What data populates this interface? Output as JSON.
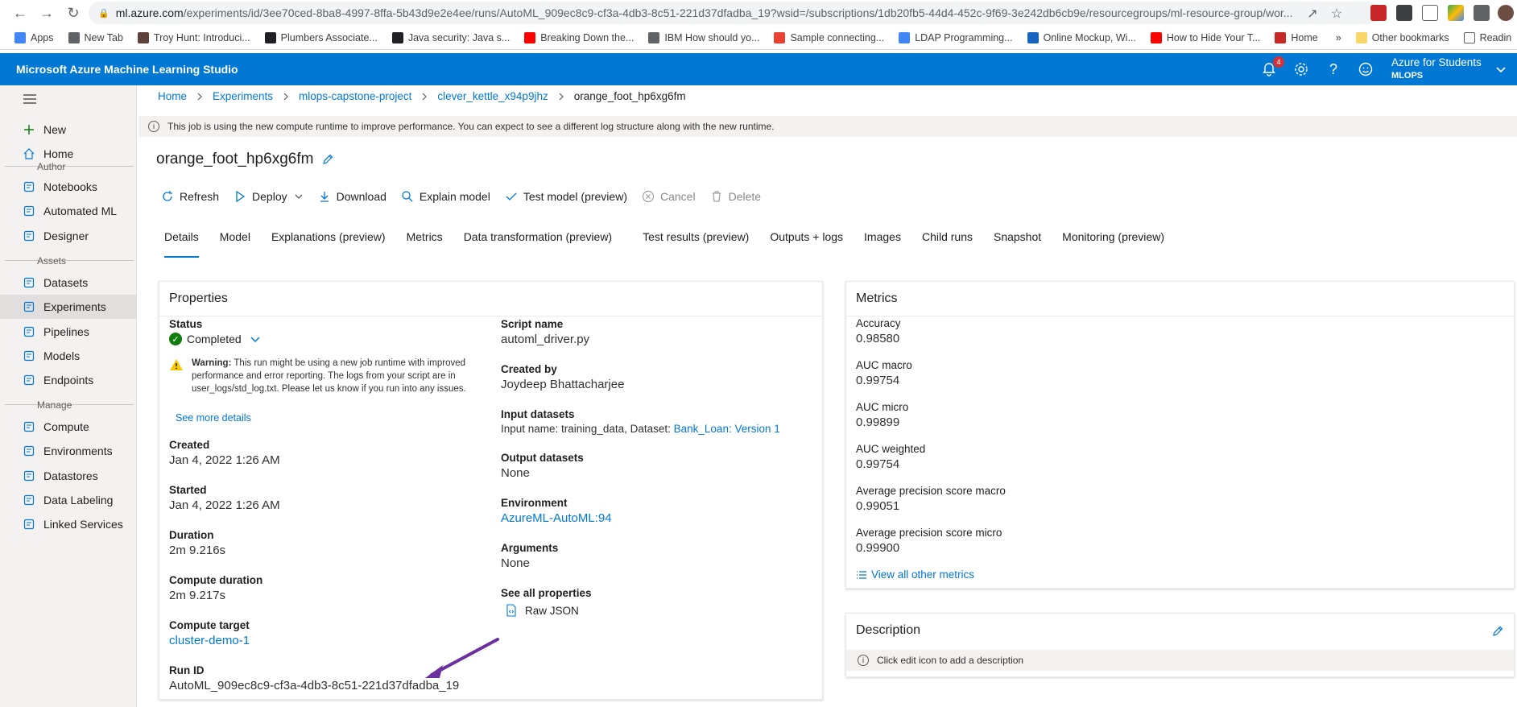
{
  "browser": {
    "url_host": "ml.azure.com",
    "url_path": "/experiments/id/3ee70ced-8ba8-4997-8ffa-5b43d9e2e4ee/runs/AutoML_909ec8c9-cf3a-4db3-8c51-221d37dfadba_19?wsid=/subscriptions/1db20fb5-44d4-452c-9f69-3e242db6cb9e/resourcegroups/ml-resource-group/wor...",
    "bookmarks": [
      {
        "label": "Apps",
        "color": "#4285f4"
      },
      {
        "label": "New Tab",
        "color": "#5f6368"
      },
      {
        "label": "Troy Hunt: Introduci...",
        "color": "#5d4037"
      },
      {
        "label": "Plumbers Associate...",
        "color": "#202124"
      },
      {
        "label": "Java security: Java s...",
        "color": "#202124"
      },
      {
        "label": "Breaking Down the...",
        "color": "#ff0000"
      },
      {
        "label": "IBM How should yo...",
        "color": "#5f6368"
      },
      {
        "label": "Sample connecting...",
        "color": "#ea4335"
      },
      {
        "label": "LDAP Programming...",
        "color": "#4285f4"
      },
      {
        "label": "Online Mockup, Wi...",
        "color": "#1565c0"
      },
      {
        "label": "How to Hide Your T...",
        "color": "#ff0000"
      },
      {
        "label": "Home",
        "color": "#c62828"
      }
    ],
    "more_bookmarks": "»",
    "other_bookmarks": "Other bookmarks",
    "reading_list": "Readin"
  },
  "header": {
    "title": "Microsoft Azure Machine Learning Studio",
    "notif_count": "4",
    "account_name": "Azure for Students",
    "account_sub": "MLOPS"
  },
  "sidebar": {
    "items": [
      {
        "label": "New",
        "icon": "plus-icon"
      },
      {
        "label": "Home",
        "icon": "home-icon"
      }
    ],
    "author_label": "Author",
    "author_items": [
      {
        "label": "Notebooks",
        "icon": "notebook-icon"
      },
      {
        "label": "Automated ML",
        "icon": "automl-icon"
      },
      {
        "label": "Designer",
        "icon": "designer-icon"
      }
    ],
    "assets_label": "Assets",
    "assets_items": [
      {
        "label": "Datasets",
        "icon": "dataset-icon"
      },
      {
        "label": "Experiments",
        "icon": "flask-icon"
      },
      {
        "label": "Pipelines",
        "icon": "pipeline-icon"
      },
      {
        "label": "Models",
        "icon": "model-icon"
      },
      {
        "label": "Endpoints",
        "icon": "endpoint-icon"
      }
    ],
    "manage_label": "Manage",
    "manage_items": [
      {
        "label": "Compute",
        "icon": "compute-icon"
      },
      {
        "label": "Environments",
        "icon": "environment-icon"
      },
      {
        "label": "Datastores",
        "icon": "datastore-icon"
      },
      {
        "label": "Data Labeling",
        "icon": "label-icon"
      },
      {
        "label": "Linked Services",
        "icon": "link-icon"
      }
    ]
  },
  "breadcrumb": [
    "Home",
    "Experiments",
    "mlops-capstone-project",
    "clever_kettle_x94p9jhz",
    "orange_foot_hp6xg6fm"
  ],
  "notice": "This job is using the new compute runtime to improve performance. You can expect to see a different log structure along with the new runtime.",
  "run_title": "orange_foot_hp6xg6fm",
  "toolbar": {
    "refresh": "Refresh",
    "deploy": "Deploy",
    "download": "Download",
    "explain": "Explain model",
    "test": "Test model (preview)",
    "cancel": "Cancel",
    "delete": "Delete"
  },
  "tabs": [
    "Details",
    "Model",
    "Explanations (preview)",
    "Metrics",
    "Data transformation (preview)",
    "Test results (preview)",
    "Outputs + logs",
    "Images",
    "Child runs",
    "Snapshot",
    "Monitoring (preview)"
  ],
  "properties": {
    "title": "Properties",
    "status_label": "Status",
    "status_value": "Completed",
    "warning_bold": "Warning:",
    "warning_text": " This run might be using a new job runtime with improved performance and error reporting. The logs from your script are in user_logs/std_log.txt. Please let us know if you run into any issues.",
    "see_more": "See more details",
    "created_label": "Created",
    "created_value": "Jan 4, 2022 1:26 AM",
    "started_label": "Started",
    "started_value": "Jan 4, 2022 1:26 AM",
    "duration_label": "Duration",
    "duration_value": "2m 9.216s",
    "compute_duration_label": "Compute duration",
    "compute_duration_value": "2m 9.217s",
    "compute_target_label": "Compute target",
    "compute_target_value": "cluster-demo-1",
    "run_id_label": "Run ID",
    "run_id_value": "AutoML_909ec8c9-cf3a-4db3-8c51-221d37dfadba_19",
    "script_name_label": "Script name",
    "script_name_value": "automl_driver.py",
    "created_by_label": "Created by",
    "created_by_value": "Joydeep Bhattacharjee",
    "input_datasets_label": "Input datasets",
    "input_datasets_prefix": "Input name: training_data, Dataset: ",
    "input_datasets_link": "Bank_Loan: Version 1",
    "output_datasets_label": "Output datasets",
    "output_datasets_value": "None",
    "environment_label": "Environment",
    "environment_value": "AzureML-AutoML:94",
    "arguments_label": "Arguments",
    "arguments_value": "None",
    "see_all_label": "See all properties",
    "raw_json": "Raw JSON"
  },
  "metrics": {
    "title": "Metrics",
    "items": [
      {
        "label": "Accuracy",
        "value": "0.98580"
      },
      {
        "label": "AUC macro",
        "value": "0.99754"
      },
      {
        "label": "AUC micro",
        "value": "0.99899"
      },
      {
        "label": "AUC weighted",
        "value": "0.99754"
      },
      {
        "label": "Average precision score macro",
        "value": "0.99051"
      },
      {
        "label": "Average precision score micro",
        "value": "0.99900"
      }
    ],
    "view_all": "View all other metrics"
  },
  "description": {
    "title": "Description",
    "hint": "Click edit icon to add a description"
  },
  "colors": {
    "accent": "#0078d4",
    "success": "#107c10",
    "warning": "#f8c800",
    "arrow": "#6b2fa0"
  }
}
